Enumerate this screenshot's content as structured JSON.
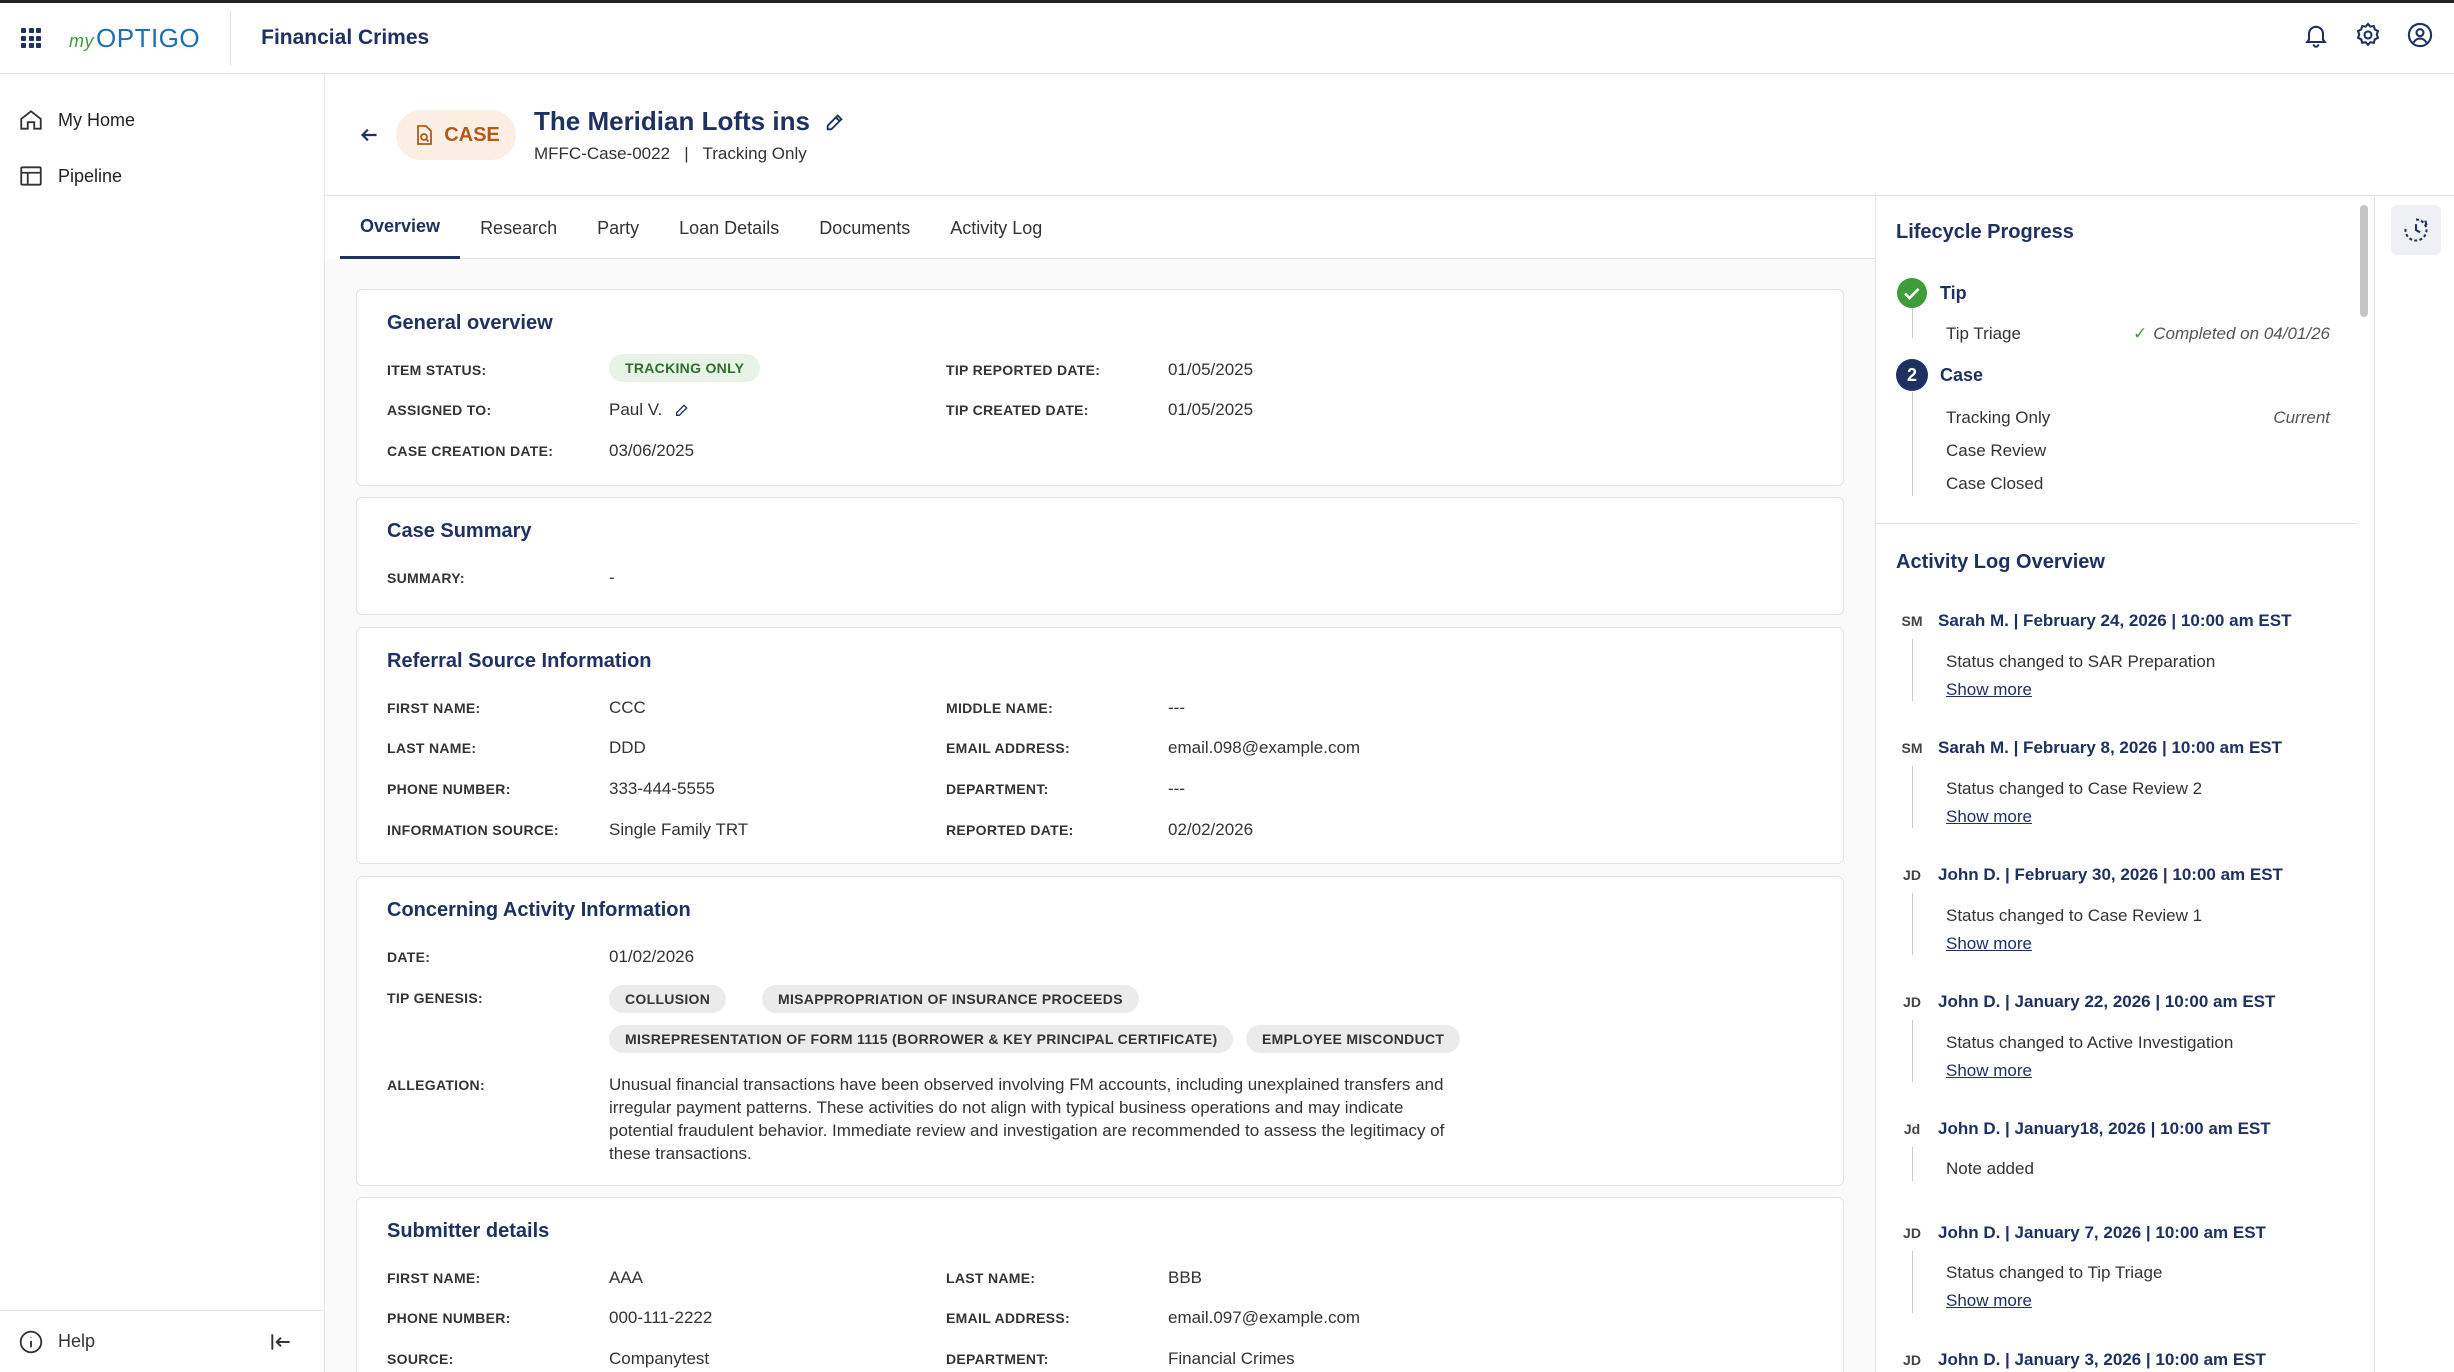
{
  "app": {
    "logo_prefix": "my",
    "logo_name": "OPTIGO",
    "title": "Financial Crimes"
  },
  "sidebar": {
    "items": [
      {
        "label": "My Home"
      },
      {
        "label": "Pipeline"
      }
    ],
    "help_label": "Help"
  },
  "header": {
    "chip_label": "CASE",
    "title": "The Meridian Lofts ins",
    "case_id": "MFFC-Case-0022",
    "separator": "|",
    "status": "Tracking Only"
  },
  "tabs": [
    "Overview",
    "Research",
    "Party",
    "Loan Details",
    "Documents",
    "Activity Log"
  ],
  "general": {
    "title": "General overview",
    "item_status_label": "ITEM STATUS:",
    "item_status": "TRACKING ONLY",
    "assigned_label": "ASSIGNED TO:",
    "assigned": "Paul V.",
    "creation_label": "CASE CREATION DATE:",
    "creation": "03/06/2025",
    "tip_reported_label": "TIP REPORTED DATE:",
    "tip_reported": "01/05/2025",
    "tip_created_label": "TIP CREATED DATE:",
    "tip_created": "01/05/2025"
  },
  "summary": {
    "title": "Case Summary",
    "label": "SUMMARY:",
    "value": "-"
  },
  "referral": {
    "title": "Referral Source Information",
    "first_label": "FIRST NAME:",
    "first": "CCC",
    "last_label": "LAST NAME:",
    "last": "DDD",
    "phone_label": "PHONE NUMBER:",
    "phone": "333-444-5555",
    "source_label": "INFORMATION SOURCE:",
    "source": "Single Family TRT",
    "middle_label": "MIDDLE NAME:",
    "middle": "---",
    "email_label": "EMAIL ADDRESS:",
    "email": "email.098@example.com",
    "dept_label": "DEPARTMENT:",
    "dept": "---",
    "reported_label": "REPORTED DATE:",
    "reported": "02/02/2026"
  },
  "concerning": {
    "title": "Concerning Activity Information",
    "date_label": "DATE:",
    "date": "01/02/2026",
    "genesis_label": "TIP GENESIS:",
    "tags": [
      "COLLUSION",
      "MISAPPROPRIATION OF INSURANCE PROCEEDS",
      "MISREPRESENTATION OF FORM 1115 (BORROWER & KEY PRINCIPAL CERTIFICATE)",
      "EMPLOYEE MISCONDUCT"
    ],
    "allegation_label": "ALLEGATION:",
    "allegation": "Unusual financial transactions have been observed involving FM accounts, including unexplained transfers and irregular payment patterns. These activities do not align with typical business operations and may indicate potential fraudulent behavior. Immediate review and investigation are recommended to assess the legitimacy of these transactions."
  },
  "submitter": {
    "title": "Submitter details",
    "first_label": "FIRST NAME:",
    "first": "AAA",
    "phone_label": "PHONE NUMBER:",
    "phone": "000-111-2222",
    "source_label": "SOURCE:",
    "source": "Companytest",
    "last_label": "LAST NAME:",
    "last": "BBB",
    "email_label": "EMAIL ADDRESS:",
    "email": "email.097@example.com",
    "dept_label": "DEPARTMENT:",
    "dept": "Financial Crimes"
  },
  "lifecycle": {
    "title": "Lifecycle Progress",
    "stage1": "Tip",
    "stage1_step": "Tip Triage",
    "stage1_note": "Completed on 04/01/26",
    "stage2_num": "2",
    "stage2": "Case",
    "steps": [
      "Tracking Only",
      "Case Review",
      "Case Closed"
    ],
    "current_label": "Current"
  },
  "activity": {
    "title": "Activity Log Overview",
    "show_more": "Show more",
    "entries": [
      {
        "initials": "SM",
        "head": "Sarah M. | February 24, 2026 | 10:00 am EST",
        "text": "Status changed to SAR Preparation"
      },
      {
        "initials": "SM",
        "head": "Sarah M. | February 8, 2026 | 10:00 am EST",
        "text": "Status changed to Case Review 2"
      },
      {
        "initials": "JD",
        "head": "John D. | February 30, 2026 | 10:00 am EST",
        "text": "Status changed to Case Review 1"
      },
      {
        "initials": "JD",
        "head": "John D. | January 22, 2026 | 10:00 am EST",
        "text": "Status changed to Active Investigation"
      },
      {
        "initials": "Jd",
        "head": "John D. | January18, 2026 | 10:00 am EST",
        "text": "Note added"
      },
      {
        "initials": "JD",
        "head": "John D. | January 7, 2026 | 10:00 am EST",
        "text": "Status changed to Tip Triage"
      },
      {
        "initials": "JD",
        "head": "John D. | January 3, 2026 | 10:00 am EST",
        "text": ""
      }
    ]
  },
  "colors": {
    "navy": "#1e3161",
    "accent_orange": "#b25a1a",
    "success_green": "#3f9c3a"
  }
}
